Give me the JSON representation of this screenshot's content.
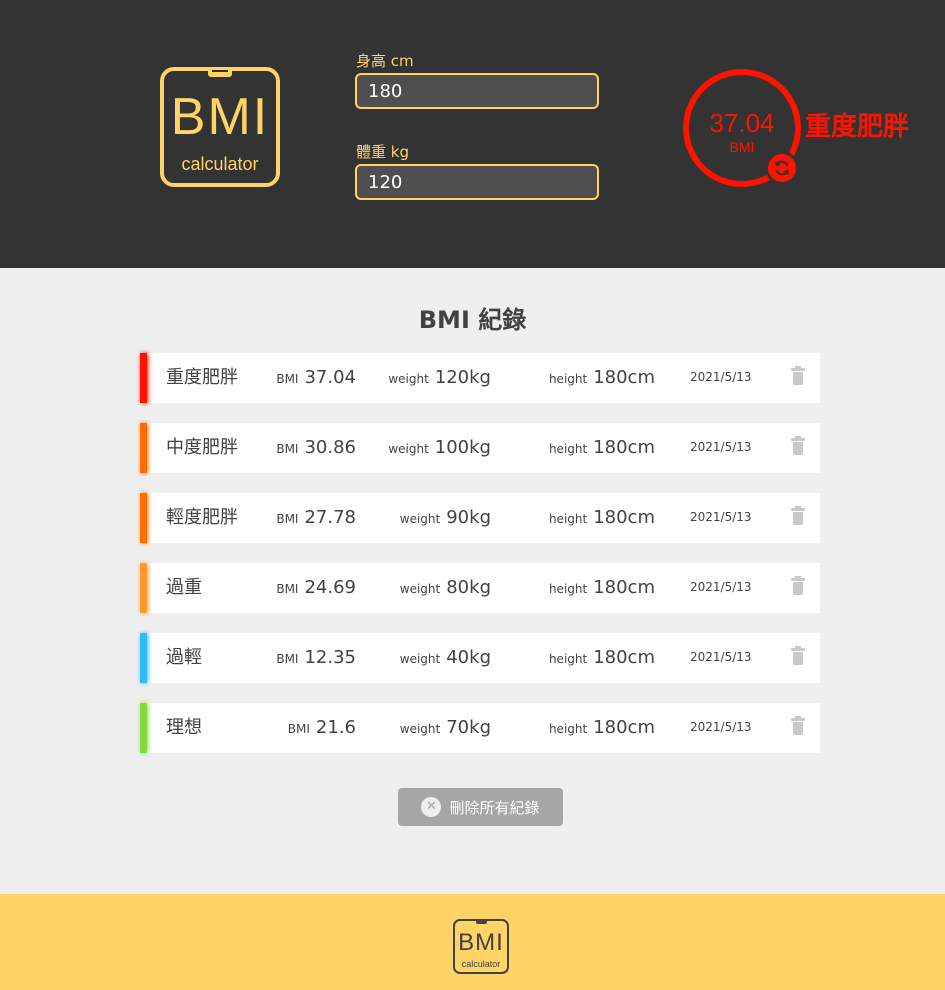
{
  "logo": {
    "title": "BMI",
    "subtitle": "calculator"
  },
  "form": {
    "height_label": "身高 cm",
    "height_value": "180",
    "weight_label": "體重 kg",
    "weight_value": "120"
  },
  "result": {
    "bmi": "37.04",
    "unit": "BMI",
    "status": "重度肥胖",
    "color": "#ff1200"
  },
  "records_title": "BMI 紀錄",
  "record_labels": {
    "bmi": "BMI",
    "weight": "weight",
    "height": "height"
  },
  "records": [
    {
      "status": "重度肥胖",
      "bmi": "37.04",
      "weight": "120kg",
      "height": "180cm",
      "date": "2021/5/13",
      "color": "#ff1200"
    },
    {
      "status": "中度肥胖",
      "bmi": "30.86",
      "weight": "100kg",
      "height": "180cm",
      "date": "2021/5/13",
      "color": "#ff6c02"
    },
    {
      "status": "輕度肥胖",
      "bmi": "27.78",
      "weight": "90kg",
      "height": "180cm",
      "date": "2021/5/13",
      "color": "#ff6c02"
    },
    {
      "status": "過重",
      "bmi": "24.69",
      "weight": "80kg",
      "height": "180cm",
      "date": "2021/5/13",
      "color": "#ff982d"
    },
    {
      "status": "過輕",
      "bmi": "12.35",
      "weight": "40kg",
      "height": "180cm",
      "date": "2021/5/13",
      "color": "#31baf9"
    },
    {
      "status": "理想",
      "bmi": "21.6",
      "weight": "70kg",
      "height": "180cm",
      "date": "2021/5/13",
      "color": "#86d73f"
    }
  ],
  "clear_button": "刪除所有紀錄",
  "icons": {
    "refresh": "refresh-icon",
    "trash": "trash-icon",
    "clear": "close-circle-icon"
  },
  "colors": {
    "header_bg": "#333333",
    "accent": "#ffd366",
    "page_bg": "#efefef"
  }
}
